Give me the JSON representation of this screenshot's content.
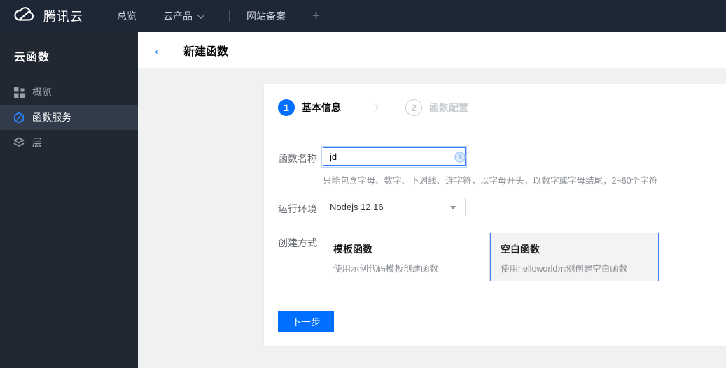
{
  "colors": {
    "accent_blue": "#006eff",
    "topnav_bg": "#1e2736",
    "sidebar_bg": "#222831",
    "sidebar_active_bg": "#313b49",
    "page_bg": "#f0f1f2",
    "input_focus_border": "#2d7af7",
    "selected_card_border": "#3e80f6",
    "selected_card_bg": "#f3f3f3",
    "step_inactive": "#c9cdd1"
  },
  "topnav": {
    "brand": "腾讯云",
    "items": [
      {
        "label": "总览"
      },
      {
        "label": "云产品"
      },
      {
        "label": "网站备案"
      }
    ],
    "plus": "+"
  },
  "sidebar": {
    "title": "云函数",
    "items": [
      {
        "label": "概览",
        "icon": "grid-icon",
        "active": false
      },
      {
        "label": "函数服务",
        "icon": "function-service-icon",
        "active": true
      },
      {
        "label": "层",
        "icon": "layers-icon",
        "active": false
      }
    ]
  },
  "header": {
    "back_arrow": "←",
    "title": "新建函数"
  },
  "wizard": {
    "steps": [
      {
        "number": "1",
        "label": "基本信息",
        "active": true
      },
      {
        "number": "2",
        "label": "函数配置",
        "active": false
      }
    ]
  },
  "form": {
    "name_label": "函数名称",
    "name_value": "jd",
    "name_hint": "只能包含字母、数字、下划线、连字符，以字母开头，以数字或字母结尾，2~60个字符",
    "runtime_label": "运行环境",
    "runtime_value": "Nodejs 12.16",
    "method_label": "创建方式",
    "method_options": [
      {
        "title": "模板函数",
        "desc": "使用示例代码模板创建函数",
        "selected": false
      },
      {
        "title": "空白函数",
        "desc": "使用helloworld示例创建空白函数",
        "selected": true
      }
    ],
    "next_button_label": "下一步"
  }
}
